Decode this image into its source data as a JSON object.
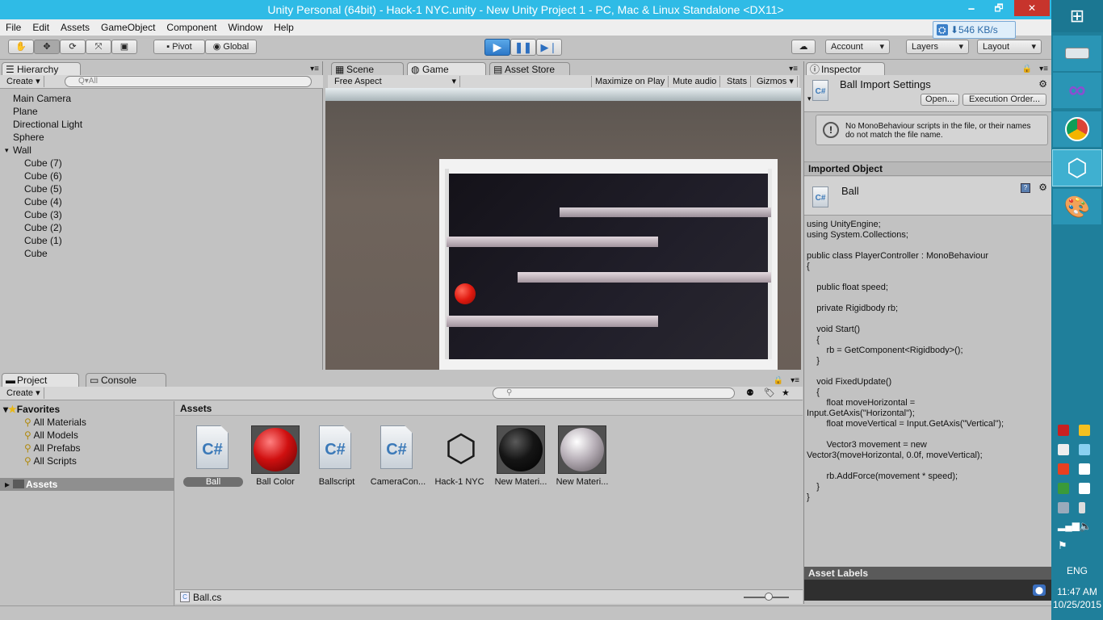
{
  "window": {
    "title": "Unity Personal (64bit) - Hack-1 NYC.unity - New Unity Project 1 - PC, Mac & Linux Standalone <DX11>",
    "minimize": "🗕",
    "restore": "🗗",
    "close": "✕"
  },
  "menu": [
    "File",
    "Edit",
    "Assets",
    "GameObject",
    "Component",
    "Window",
    "Help"
  ],
  "toolbar": {
    "pivot": "Pivot",
    "global": "Global",
    "account": "Account",
    "layers": "Layers",
    "layout": "Layout",
    "network_speed": "546 KB/s"
  },
  "hierarchy": {
    "tab": "Hierarchy",
    "create": "Create",
    "search_placeholder": "Q▾All",
    "items": [
      {
        "label": "Main Camera",
        "indent": 0
      },
      {
        "label": "Plane",
        "indent": 0
      },
      {
        "label": "Directional Light",
        "indent": 0
      },
      {
        "label": "Sphere",
        "indent": 0
      },
      {
        "label": "Wall",
        "indent": 0
      },
      {
        "label": "Cube (7)",
        "indent": 1
      },
      {
        "label": "Cube (6)",
        "indent": 1
      },
      {
        "label": "Cube (5)",
        "indent": 1
      },
      {
        "label": "Cube (4)",
        "indent": 1
      },
      {
        "label": "Cube (3)",
        "indent": 1
      },
      {
        "label": "Cube (2)",
        "indent": 1
      },
      {
        "label": "Cube (1)",
        "indent": 1
      },
      {
        "label": "Cube",
        "indent": 1
      }
    ]
  },
  "view_tabs": {
    "scene": "Scene",
    "game": "Game",
    "asset_store": "Asset Store"
  },
  "game_bar": {
    "aspect": "Free Aspect",
    "maximize": "Maximize on Play",
    "mute": "Mute audio",
    "stats": "Stats",
    "gizmos": "Gizmos"
  },
  "project": {
    "tab": "Project",
    "console_tab": "Console",
    "create": "Create",
    "favorites": "Favorites",
    "fav_items": [
      "All Materials",
      "All Models",
      "All Prefabs",
      "All Scripts"
    ],
    "assets_folder": "Assets",
    "assets_header": "Assets",
    "assets": [
      {
        "label": "Ball",
        "kind": "cs"
      },
      {
        "label": "Ball Color",
        "kind": "mat-red"
      },
      {
        "label": "Ballscript",
        "kind": "cs"
      },
      {
        "label": "CameraCon...",
        "kind": "cs"
      },
      {
        "label": "Hack-1 NYC",
        "kind": "unity"
      },
      {
        "label": "New Materi...",
        "kind": "mat-black"
      },
      {
        "label": "New Materi...",
        "kind": "mat-gray"
      }
    ],
    "status_file": "Ball.cs"
  },
  "inspector": {
    "tab": "Inspector",
    "title": "Ball Import Settings",
    "open_button": "Open...",
    "exec_button": "Execution Order...",
    "warning": "No MonoBehaviour scripts in the file, or their names do not match the file name.",
    "imported_header": "Imported Object",
    "object_name": "Ball",
    "code": "using UnityEngine;\nusing System.Collections;\n\npublic class PlayerController : MonoBehaviour\n{\n\n    public float speed;\n\n    private Rigidbody rb;\n\n    void Start()\n    {\n        rb = GetComponent<Rigidbody>();\n    }\n\n    void FixedUpdate()\n    {\n        float moveHorizontal =\nInput.GetAxis(\"Horizontal\");\n        float moveVertical = Input.GetAxis(\"Vertical\");\n\n        Vector3 movement = new\nVector3(moveHorizontal, 0.0f, moveVertical);\n\n        rb.AddForce(movement * speed);\n    }\n}",
    "asset_labels": "Asset Labels"
  },
  "taskbar": {
    "lang": "ENG",
    "time": "11:47 AM",
    "date": "10/25/2015"
  }
}
